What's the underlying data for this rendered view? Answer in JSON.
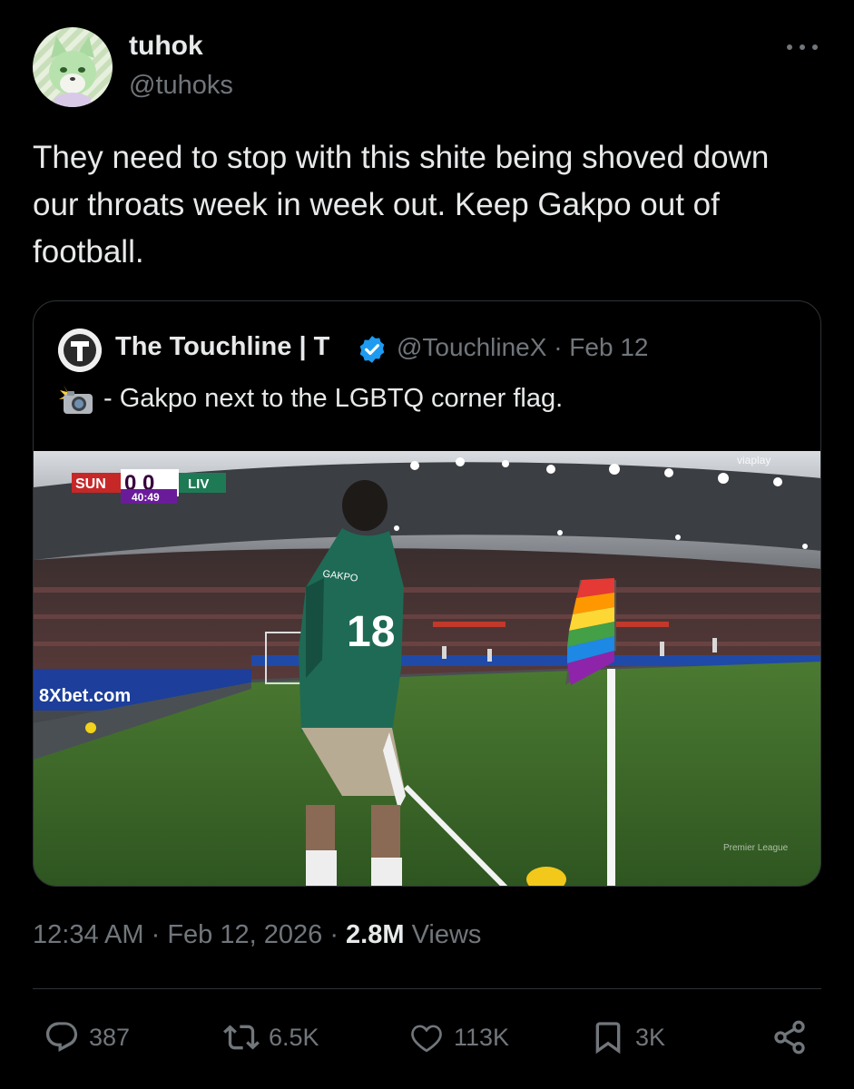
{
  "author": {
    "display_name": "tuhok",
    "handle": "@tuhoks",
    "avatar_icon": "wolf-avatar-icon"
  },
  "tweet": {
    "text": "They need to stop with this shite being shoved down our throats week in week out. Keep Gakpo out of football."
  },
  "quote": {
    "name": "The Touchline | T",
    "handle": "@TouchlineX",
    "sep": "·",
    "date": "Feb 12",
    "text": "- Gakpo next to the LGBTQ corner flag.",
    "emoji_icon": "camera-flash-icon",
    "media": {
      "scoreboard": {
        "home": "SUN",
        "score": "0 0",
        "away": "LIV",
        "clock": "40:49"
      },
      "broadcaster": "viaplay",
      "shirt_number": "18",
      "shirt_name": "GAKPO",
      "ad_board": "8Xbet.com",
      "watermark": "Premier League"
    }
  },
  "meta": {
    "time": "12:34 AM",
    "dot1": "·",
    "date": "Feb 12, 2026",
    "dot2": "·",
    "views_count": "2.8M",
    "views_label": "Views"
  },
  "actions": {
    "replies": "387",
    "reposts": "6.5K",
    "likes": "113K",
    "bookmarks": "3K"
  },
  "colors": {
    "background": "#000000",
    "text": "#e7e9ea",
    "secondary": "#71767b",
    "border": "#2f3336",
    "verified": "#1d9bf0"
  }
}
